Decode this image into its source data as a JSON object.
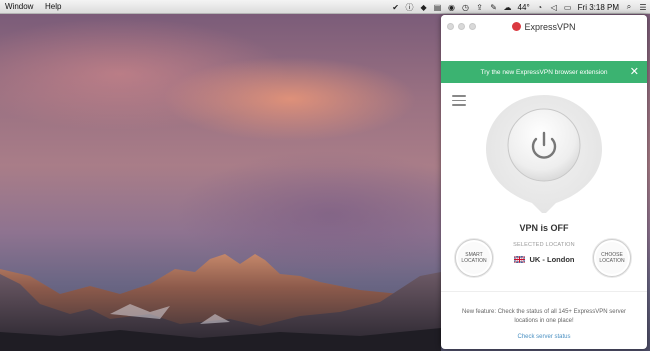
{
  "menubar": {
    "items": [
      "Window",
      "Help"
    ],
    "battery_pct": "44°",
    "clock": "Fri 3:18 PM"
  },
  "vpn": {
    "brand": "ExpressVPN",
    "banner_text": "Try the new ExpressVPN browser extension",
    "banner_close": "✕",
    "status": "VPN is OFF",
    "smart_location": "SMART\nLOCATION",
    "choose_location": "CHOOSE\nLOCATION",
    "selected_label": "SELECTED LOCATION",
    "selected_location": "UK - London",
    "footer_text": "New feature: Check the status of all 145+ ExpressVPN server locations in one place!",
    "footer_link": "Check server status",
    "accent": "#3bb371",
    "brand_color": "#da3940"
  }
}
